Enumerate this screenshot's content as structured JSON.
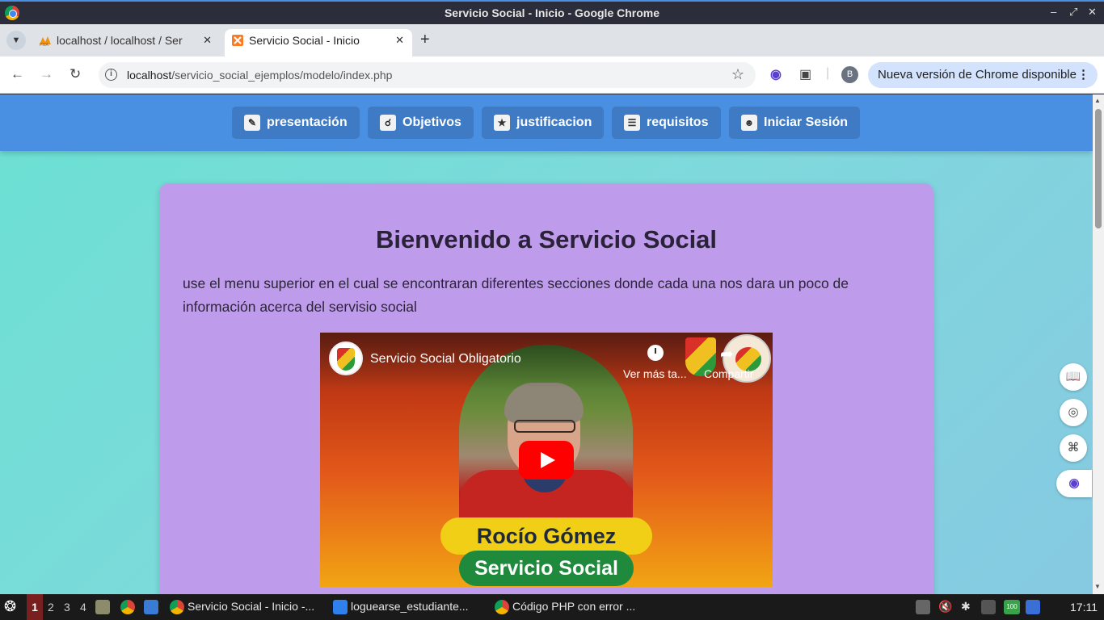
{
  "window": {
    "title": "Servicio Social - Inicio - Google Chrome"
  },
  "tabs": [
    {
      "label": "localhost / localhost / Ser",
      "active": false
    },
    {
      "label": "Servicio Social - Inicio",
      "active": true
    }
  ],
  "toolbar": {
    "url_host": "localhost",
    "url_path": "/servicio_social_ejemplos/modelo/index.php",
    "profile_initial": "B",
    "update_label": "Nueva versión de Chrome disponible"
  },
  "nav": {
    "items": [
      {
        "label": "presentación",
        "icon": "presentation-icon"
      },
      {
        "label": "Objetivos",
        "icon": "magnifier-icon"
      },
      {
        "label": "justificacion",
        "icon": "trophy-icon"
      },
      {
        "label": "requisitos",
        "icon": "document-icon"
      },
      {
        "label": "Iniciar Sesión",
        "icon": "user-icon"
      }
    ]
  },
  "content": {
    "heading": "Bienvenido a Servicio Social",
    "intro": "use el menu superior en el cual se encontraran diferentes secciones donde cada una nos dara un poco de información acerca del servisio social"
  },
  "video": {
    "title": "Servicio Social Obligatorio",
    "watch_later": "Ver más ta...",
    "share": "Compartir",
    "name_banner": "Rocío Gómez",
    "role_banner": "Servicio Social"
  },
  "taskbar": {
    "workspaces": [
      "1",
      "2",
      "3",
      "4"
    ],
    "tasks": [
      {
        "label": "Servicio Social - Inicio -..."
      },
      {
        "label": "loguearse_estudiante..."
      },
      {
        "label": "Código PHP con error ..."
      }
    ],
    "clock": "17:11",
    "battery": "100"
  },
  "colors": {
    "navbar": "#4a90e2",
    "card": "#bf9bec",
    "page_gradient_start": "#6be0d2",
    "page_gradient_end": "#86c9e2"
  }
}
